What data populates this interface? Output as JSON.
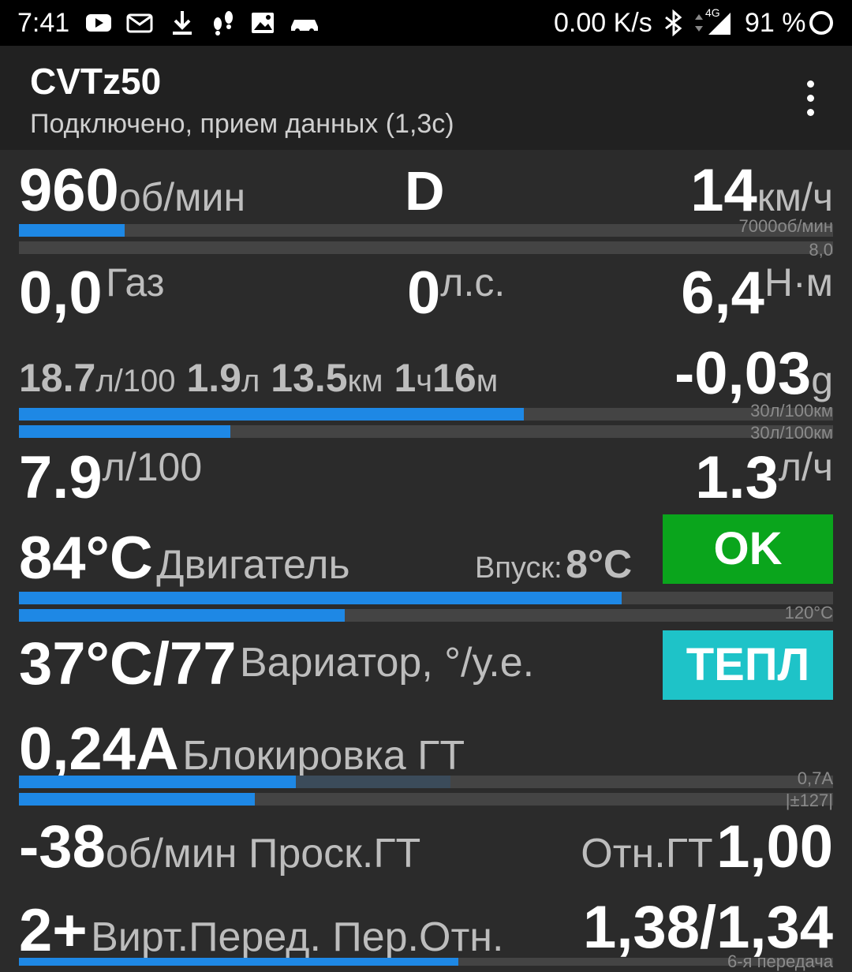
{
  "status": {
    "time": "7:41",
    "speed": "0.00 K/s",
    "network": "4G",
    "battery": "91 %"
  },
  "app": {
    "title": "CVTz50",
    "subtitle": "Подключено, прием данных (1,3с)"
  },
  "row1": {
    "rpm_value": "960",
    "rpm_unit": "об/мин",
    "gear": "D",
    "speed_value": "14",
    "speed_unit": "км/ч",
    "rpm_max": "7000об/мин",
    "bar2_label": "8,0",
    "rpm_fraction": 0.13
  },
  "row2": {
    "throttle_value": "0,0",
    "throttle_label": "Газ",
    "power_value": "0",
    "power_unit": "л.с.",
    "torque_value": "6,4",
    "torque_unit": "Н·м"
  },
  "row3": {
    "cons_value": "18.7",
    "cons_unit": "л/100",
    "fuel_value": "1.9",
    "fuel_unit": "л",
    "dist_value": "13.5",
    "dist_unit": "км",
    "time_h": "1",
    "time_h_unit": "ч",
    "time_m": "16",
    "time_m_unit": "м",
    "accel_value": "-0,03",
    "accel_unit": "g",
    "bar1_label": "30л/100км",
    "bar2_label": "30л/100км",
    "bar1_fraction": 0.62,
    "bar2_fraction": 0.26
  },
  "row4": {
    "avg_value": "7.9",
    "avg_unit": "л/100",
    "hour_value": "1.3",
    "hour_unit": "л/ч"
  },
  "row5": {
    "engine_temp": "84°C",
    "engine_label": "Двигатель",
    "intake_label": "Впуск:",
    "intake_value": "8°C",
    "status_badge": "OK",
    "bar_max": "120°C",
    "bar1_fraction": 0.74,
    "bar2_fraction": 0.4
  },
  "row6": {
    "cvt_value": "37°C/77",
    "cvt_label": "Вариатор, °/у.е.",
    "status_badge": "ТЕПЛ"
  },
  "row7": {
    "lock_value": "0,24A",
    "lock_label": "Блокировка ГТ",
    "bar1_label": "0,7A",
    "bar2_label": "|±127|",
    "bar1_fraction": 0.34,
    "bar1_secondary_fraction": 0.53,
    "bar2_fraction": 0.29
  },
  "row8": {
    "slip_value": "-38",
    "slip_label": "об/мин Проск.ГТ",
    "ratio_label": "Отн.ГТ",
    "ratio_value": "1,00"
  },
  "row9": {
    "vgear_value": "2+",
    "vgear_label": "Вирт.Перед. Пер.Отн.",
    "gear_ratio": "1,38/1,34",
    "bar_label": "6-я передача"
  },
  "colors": {
    "bar": "#1e88e5",
    "ok": "#0aa51c",
    "warm": "#1ec3c8"
  }
}
